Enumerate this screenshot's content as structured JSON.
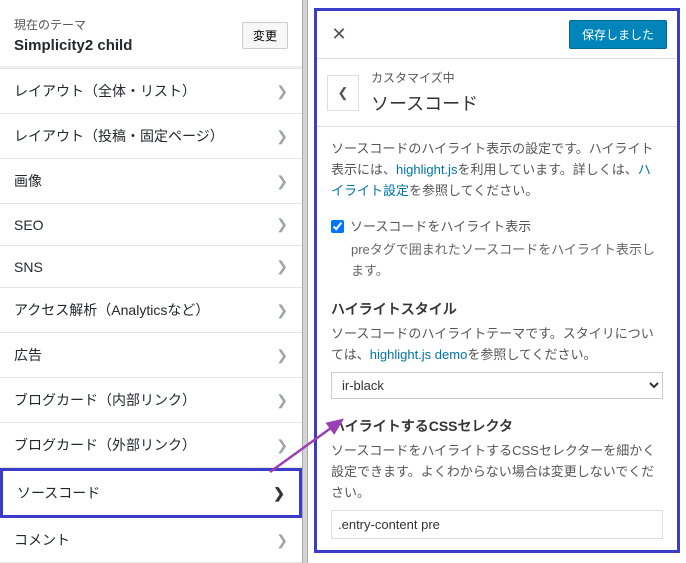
{
  "theme": {
    "current_label": "現在のテーマ",
    "name": "Simplicity2 child",
    "change_button": "変更"
  },
  "menu": {
    "items": [
      {
        "label": "レイアウト（全体・リスト）"
      },
      {
        "label": "レイアウト（投稿・固定ページ）"
      },
      {
        "label": "画像"
      },
      {
        "label": "SEO"
      },
      {
        "label": "SNS"
      },
      {
        "label": "アクセス解析（Analyticsなど）"
      },
      {
        "label": "広告"
      },
      {
        "label": "ブログカード（内部リンク）"
      },
      {
        "label": "ブログカード（外部リンク）"
      },
      {
        "label": "ソースコード"
      },
      {
        "label": "コメント"
      }
    ]
  },
  "panel": {
    "save_button": "保存しました",
    "breadcrumb_small": "カスタマイズ中",
    "breadcrumb_big": "ソースコード",
    "desc_1": "ソースコードのハイライト表示の設定です。ハイライト表示には、",
    "desc_link1": "highlight.js",
    "desc_2": "を利用しています。詳しくは、",
    "desc_link2": "ハイライト設定",
    "desc_3": "を参照してください。",
    "checkbox_label": "ソースコードをハイライト表示",
    "checkbox_desc": "preタグで囲まれたソースコードをハイライト表示します。",
    "style_title": "ハイライトスタイル",
    "style_desc_1": "ソースコードのハイライトテーマです。スタイリについては、",
    "style_link": "highlight.js demo",
    "style_desc_2": "を参照してください。",
    "style_selected": "ir-black",
    "selector_title": "ハイライトするCSSセレクタ",
    "selector_desc": "ソースコードをハイライトするCSSセレクターを細かく設定できます。よくわからない場合は変更しないでください。",
    "selector_value": ".entry-content pre"
  }
}
